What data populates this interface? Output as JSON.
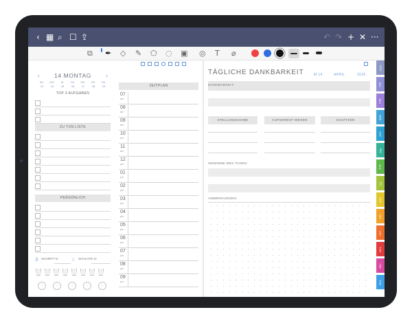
{
  "navbar": {
    "back": "‹",
    "grid": "▦",
    "search": "⌕",
    "bookmark": "☐",
    "share": "⇪",
    "undo": "↶",
    "redo": "↷",
    "add": "+",
    "close": "✕",
    "more": "···"
  },
  "toolbar": {
    "tools": [
      "lasso-icon",
      "pen-icon",
      "eraser-icon",
      "highlighter-icon",
      "shapes-icon",
      "lasso-select-icon",
      "image-icon",
      "camera-icon",
      "text-icon",
      "laser-icon"
    ],
    "colors": [
      "#ef4343",
      "#2f6de0",
      "#111111"
    ]
  },
  "day": {
    "prev": "‹",
    "title": "14 MONTAG",
    "next": "›",
    "weekdays": [
      "SO.",
      "MO.",
      "DI.",
      "MI.",
      "DO.",
      "FR.",
      "SA."
    ],
    "dates": [
      "13",
      "14",
      "15",
      "16",
      "17",
      "18",
      "19"
    ]
  },
  "left": {
    "top3": "TOP 3 AUFGABEN",
    "todo": "ZU TUN LISTE",
    "personal": "PERSÖNLICH",
    "steps": "SCHRITT E:",
    "sleep": "SCHLAFE N:"
  },
  "schedule": {
    "title": "ZEITPLAN",
    "hours": [
      {
        "h": "07",
        "p": "am"
      },
      {
        "h": "08",
        "p": "am"
      },
      {
        "h": "09",
        "p": "am"
      },
      {
        "h": "10",
        "p": "am"
      },
      {
        "h": "11",
        "p": "am"
      },
      {
        "h": "12",
        "p": "pm"
      },
      {
        "h": "01",
        "p": "pm"
      },
      {
        "h": "02",
        "p": "pm"
      },
      {
        "h": "03",
        "p": "pm"
      },
      {
        "h": "04",
        "p": "pm"
      },
      {
        "h": "05",
        "p": "pm"
      },
      {
        "h": "06",
        "p": "pm"
      },
      {
        "h": "07",
        "p": "pm"
      },
      {
        "h": "08",
        "p": "pm"
      },
      {
        "h": "09",
        "p": "pm"
      }
    ]
  },
  "gratitude": {
    "title": "TÄGLICHE DANKBARKEIT",
    "day": "M 14",
    "month": "APRIL",
    "year": "2025",
    "dankbarkeit": "DANKBARKEIT:",
    "col1": "STELLUNGNAHME",
    "col2": "AUFGEREGT WEGEN",
    "col3": "SCHÄTZEN",
    "gewinne": "GEWINNE DES TAGES:",
    "notes": "ANMERKUNGEN:"
  },
  "tabs": [
    {
      "label": "2025",
      "color": "#8d98c4"
    },
    {
      "label": "JAN",
      "color": "#8f8fd8"
    },
    {
      "label": "FEB",
      "color": "#9b7fd8"
    },
    {
      "label": "MÄR",
      "color": "#43a3d8"
    },
    {
      "label": "APR",
      "color": "#2fa0d2"
    },
    {
      "label": "MAI",
      "color": "#34b39a"
    },
    {
      "label": "JUN",
      "color": "#5fb84a"
    },
    {
      "label": "JUL",
      "color": "#a3c43c"
    },
    {
      "label": "AUG",
      "color": "#e4c52c"
    },
    {
      "label": "SEP",
      "color": "#f1a02a"
    },
    {
      "label": "OKT",
      "color": "#ee6f2d"
    },
    {
      "label": "NOV",
      "color": "#e23b3b"
    },
    {
      "label": "DEZ",
      "color": "#d84aa0"
    },
    {
      "label": "ZIEL",
      "color": "#3f9fe6"
    }
  ]
}
